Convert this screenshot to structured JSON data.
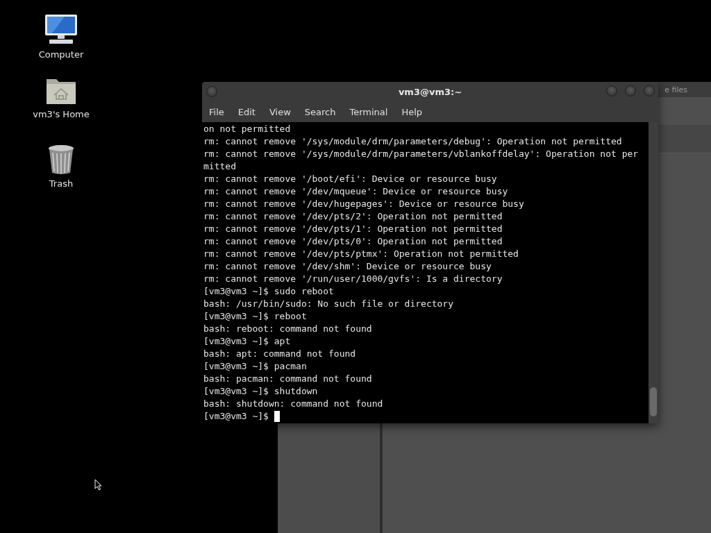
{
  "desktop_icons": [
    {
      "kind": "computer",
      "label": "Computer"
    },
    {
      "kind": "home",
      "label": "vm3's Home"
    },
    {
      "kind": "trash",
      "label": "Trash"
    }
  ],
  "background_window": {
    "title": "e files"
  },
  "terminal": {
    "title": "vm3@vm3:~",
    "menu": [
      "File",
      "Edit",
      "View",
      "Search",
      "Terminal",
      "Help"
    ],
    "lines": [
      "on not permitted",
      "rm: cannot remove '/sys/module/drm/parameters/debug': Operation not permitted",
      "rm: cannot remove '/sys/module/drm/parameters/vblankoffdelay': Operation not per",
      "mitted",
      "rm: cannot remove '/boot/efi': Device or resource busy",
      "rm: cannot remove '/dev/mqueue': Device or resource busy",
      "rm: cannot remove '/dev/hugepages': Device or resource busy",
      "rm: cannot remove '/dev/pts/2': Operation not permitted",
      "rm: cannot remove '/dev/pts/1': Operation not permitted",
      "rm: cannot remove '/dev/pts/0': Operation not permitted",
      "rm: cannot remove '/dev/pts/ptmx': Operation not permitted",
      "rm: cannot remove '/dev/shm': Device or resource busy",
      "rm: cannot remove '/run/user/1000/gvfs': Is a directory",
      "[vm3@vm3 ~]$ sudo reboot",
      "bash: /usr/bin/sudo: No such file or directory",
      "[vm3@vm3 ~]$ reboot",
      "bash: reboot: command not found",
      "[vm3@vm3 ~]$ apt",
      "bash: apt: command not found",
      "[vm3@vm3 ~]$ pacman",
      "bash: pacman: command not found",
      "[vm3@vm3 ~]$ shutdown",
      "bash: shutdown: command not found"
    ],
    "prompt": "[vm3@vm3 ~]$"
  }
}
